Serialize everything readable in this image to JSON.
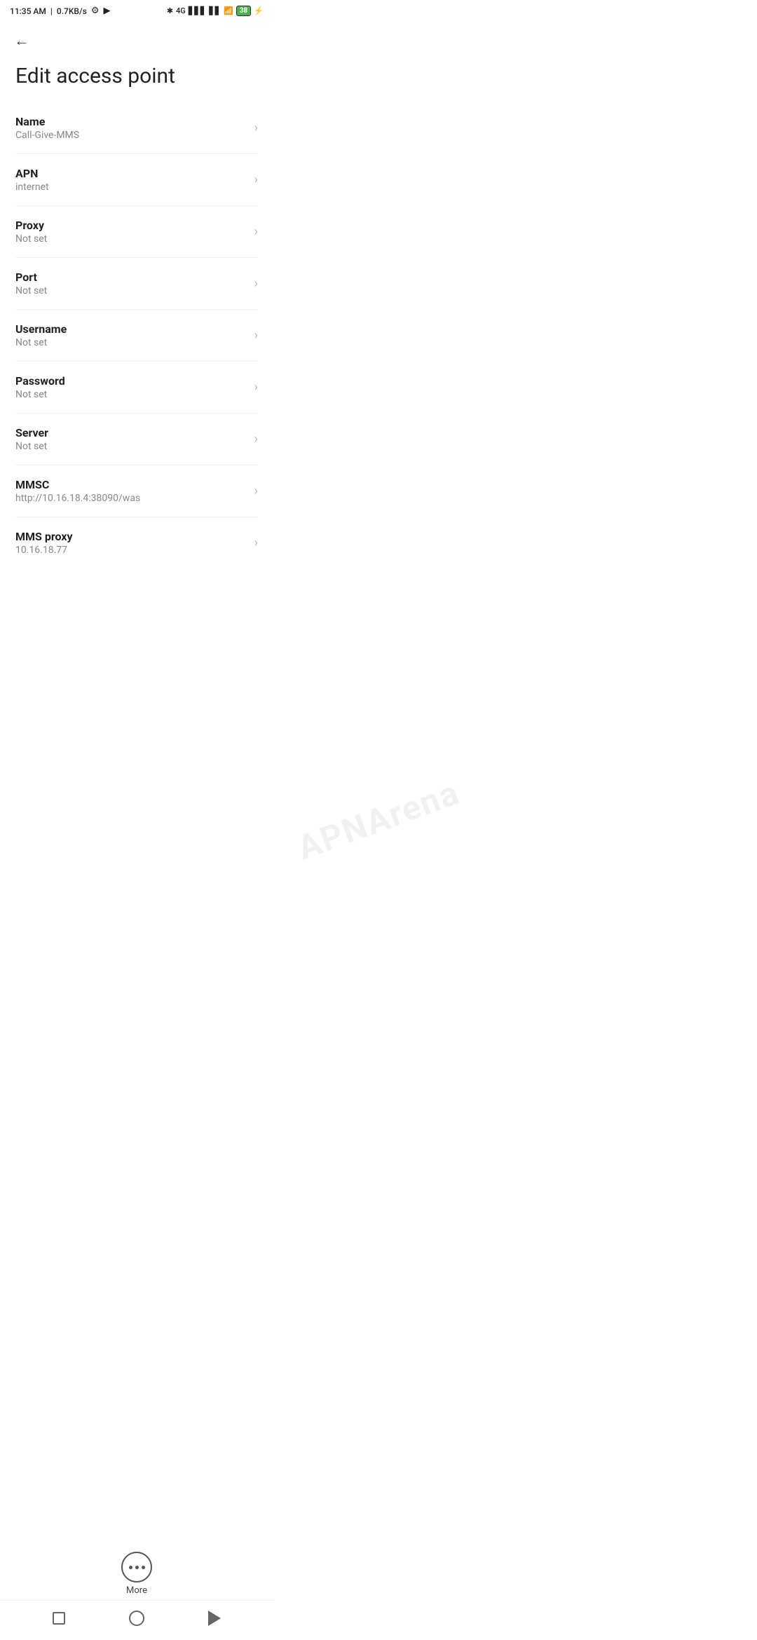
{
  "statusBar": {
    "time": "11:35 AM",
    "network": "0.7KB/s",
    "battery": "38"
  },
  "header": {
    "back_label": "←",
    "title": "Edit access point"
  },
  "fields": [
    {
      "label": "Name",
      "value": "Call-Give-MMS"
    },
    {
      "label": "APN",
      "value": "internet"
    },
    {
      "label": "Proxy",
      "value": "Not set"
    },
    {
      "label": "Port",
      "value": "Not set"
    },
    {
      "label": "Username",
      "value": "Not set"
    },
    {
      "label": "Password",
      "value": "Not set"
    },
    {
      "label": "Server",
      "value": "Not set"
    },
    {
      "label": "MMSC",
      "value": "http://10.16.18.4:38090/was"
    },
    {
      "label": "MMS proxy",
      "value": "10.16.18.77"
    }
  ],
  "more": {
    "label": "More"
  },
  "watermark": "APNArena"
}
